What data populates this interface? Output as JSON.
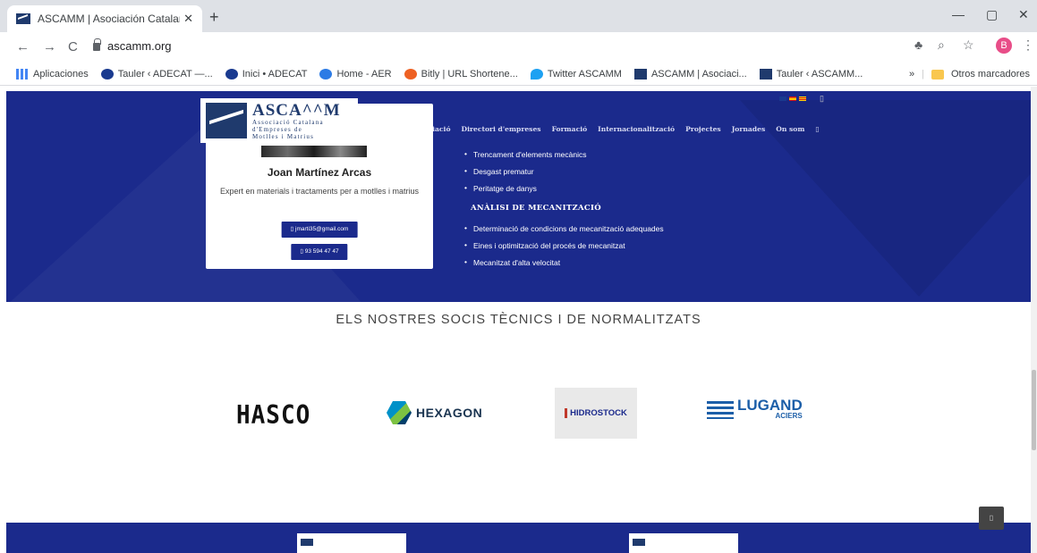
{
  "browser": {
    "tab_title": "ASCAMM | Asociación Catalana d",
    "tab_close": "✕",
    "new_tab": "+",
    "url": "ascamm.org",
    "minimize": "—",
    "maximize": "▢",
    "close": "✕",
    "back": "←",
    "forward": "→",
    "reload": "C",
    "profile_initial": "B",
    "bookmarks": [
      {
        "label": "Aplicaciones",
        "icon": "apps-icon"
      },
      {
        "label": "Tauler ‹ ADECAT —...",
        "icon": "adecat-icon"
      },
      {
        "label": "Inici • ADECAT",
        "icon": "adecat-icon"
      },
      {
        "label": "Home - AER",
        "icon": "aer-icon"
      },
      {
        "label": "Bitly | URL Shortene...",
        "icon": "bitly-icon"
      },
      {
        "label": "Twitter ASCAMM",
        "icon": "twitter-icon"
      },
      {
        "label": "ASCAMM | Asociaci...",
        "icon": "ascamm-icon"
      },
      {
        "label": "Tauler ‹ ASCAMM...",
        "icon": "ascamm-icon"
      }
    ],
    "more_bookmarks": "»",
    "other_bookmarks": "Otros marcadores"
  },
  "site": {
    "logo": {
      "name": "ASCA^^M",
      "line1": "Associació Catalana",
      "line2": "d'Empreses de",
      "line3": "Motlles i Matrius"
    },
    "nav": [
      "Associació",
      "Directori d'empreses",
      "Formació",
      "Internacionalització",
      "Projectes",
      "Jornades",
      "On som",
      "▯"
    ],
    "lang_extra": "▯"
  },
  "expert_card": {
    "name": "Joan Martínez Arcas",
    "description": "Expert en materials i tractaments per a motlles i matrius",
    "email": "▯ jmarti35@gmail.com",
    "phone": "▯ 93 594 47 47"
  },
  "services": {
    "group1": [
      "Trencament d'elements mecànics",
      "Desgast prematur",
      "Peritatge de danys"
    ],
    "heading2": "ANÀLISI DE MECANITZACIÓ",
    "group2": [
      "Determinació de condicions de mecanització adequades",
      "Eines i optimització del procés de mecanitzat",
      "Mecanitzat d'alta velocitat"
    ]
  },
  "partners": {
    "title": "ELS NOSTRES SOCIS TÈCNICS I DE NORMALITZATS",
    "hasco": "HASCO",
    "hexagon": "HEXAGON",
    "hidrostock": "HIDROSTOCK",
    "lugand": "LUGAND",
    "lugand_sub": "ACIERS"
  },
  "scroll_top": "▯"
}
